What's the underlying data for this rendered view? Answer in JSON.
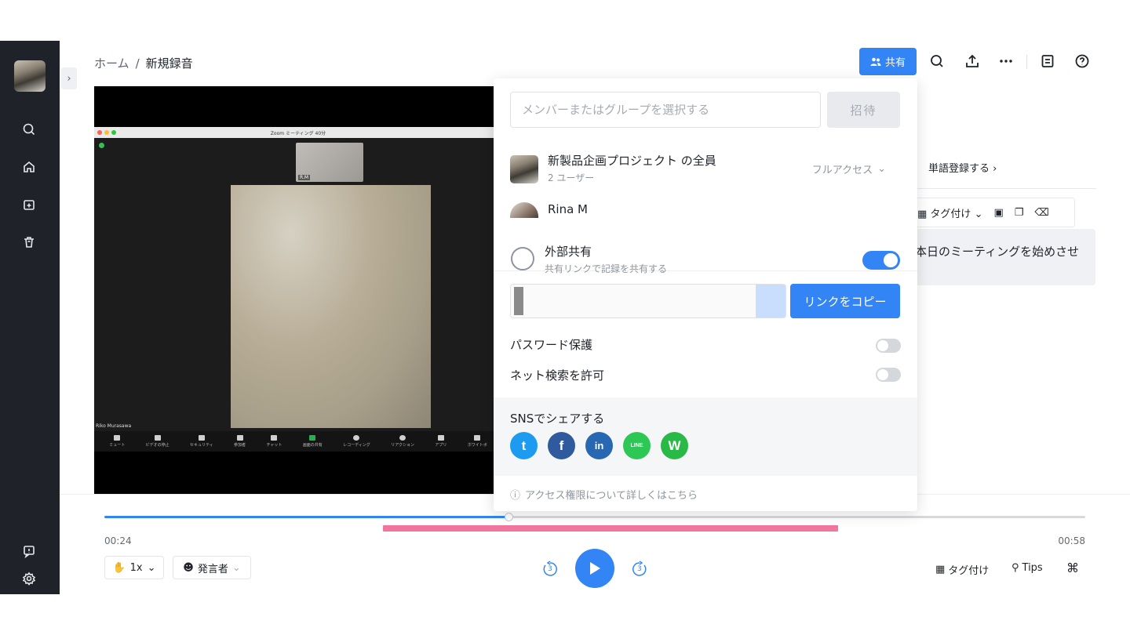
{
  "breadcrumb": {
    "home": "ホーム",
    "separator": "/",
    "current": "新規録音"
  },
  "header": {
    "share_label": "共有"
  },
  "video": {
    "zoom_title": "Zoom ミーティング 40分",
    "thumb_label": "R.M",
    "participant_name": "Riko Murasawa",
    "toolbar": [
      "ミュート",
      "ビデオの停止",
      "セキュリティ",
      "参加者",
      "チャット",
      "画面の共有",
      "レコーディング",
      "リアクション",
      "アプリ",
      "ホワイトボ"
    ]
  },
  "right_panel": {
    "word_register": "単語登録する",
    "tag_label": "タグ付け",
    "transcript_snippet": "本日のミーティングを始めさせ"
  },
  "share_popover": {
    "invite_placeholder": "メンバーまたはグループを選択する",
    "invite_button": "招待",
    "members": [
      {
        "name": "新製品企画プロジェクト の全員",
        "sub": "2 ユーザー",
        "permission": "フルアクセス"
      },
      {
        "name": "Rina M",
        "sub": "",
        "permission": ""
      }
    ],
    "external_share_title": "外部共有",
    "external_share_sub": "共有リンクで記録を共有する",
    "external_share_enabled": true,
    "copy_link_button": "リンクをコピー",
    "password_label": "パスワード保護",
    "password_enabled": false,
    "search_label": "ネット検索を許可",
    "search_enabled": false,
    "sns_title": "SNSでシェアする",
    "sns": [
      {
        "name": "twitter-icon",
        "color": "#1d9bf0",
        "glyph": "t"
      },
      {
        "name": "facebook-icon",
        "color": "#2f5b9e",
        "glyph": "f"
      },
      {
        "name": "linkedin-icon",
        "color": "#2867b2",
        "glyph": "in"
      },
      {
        "name": "line-icon",
        "color": "#2dc755",
        "glyph": "LINE"
      },
      {
        "name": "whatsapp-icon",
        "color": "#29b946",
        "glyph": "W"
      }
    ],
    "help_link": "アクセス権限について詳しくはこちら"
  },
  "player": {
    "current_time": "00:24",
    "total_time": "00:58",
    "progress": 0.412,
    "speed": "1x",
    "speaker_label": "発言者",
    "skip_seconds": "3",
    "tag_label": "タグ付け",
    "tips_label": "Tips"
  },
  "colors": {
    "accent": "#3385f5",
    "sidebar": "#1f2329",
    "highlight": "#f0759f"
  }
}
